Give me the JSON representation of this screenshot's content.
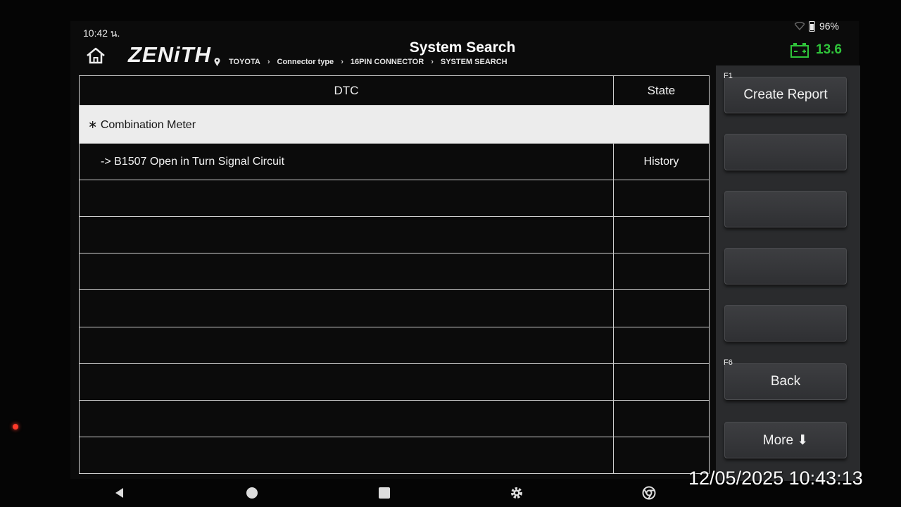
{
  "status": {
    "time": "10:42 น.",
    "battery": "96%"
  },
  "header": {
    "logo": "ZENiTH",
    "title": "System Search",
    "breadcrumb": [
      "TOYOTA",
      "Connector type",
      "16PIN CONNECTOR",
      "SYSTEM SEARCH"
    ],
    "voltage": "13.6"
  },
  "table": {
    "columns": [
      "DTC",
      "State"
    ],
    "group": "∗ Combination Meter",
    "rows": [
      {
        "code": "->  B1507 Open in Turn Signal Circuit",
        "state": "History"
      }
    ]
  },
  "fkeys": [
    {
      "fnum": "F1",
      "label": "Create Report"
    },
    {
      "fnum": "",
      "label": ""
    },
    {
      "fnum": "",
      "label": ""
    },
    {
      "fnum": "",
      "label": ""
    },
    {
      "fnum": "",
      "label": ""
    },
    {
      "fnum": "F6",
      "label": "Back"
    },
    {
      "fnum": "",
      "label": "More ⬇"
    }
  ],
  "overlay": {
    "timestamp": "12/05/2025 10:43:13"
  },
  "colors": {
    "voltage": "#2fc43a",
    "group_row": "#ececec",
    "panel": "#2a2b2d"
  },
  "icons": [
    "home-icon",
    "pin-icon",
    "battery-icon",
    "back-nav-icon",
    "home-nav-icon",
    "recents-nav-icon",
    "settings-nav-icon",
    "browser-nav-icon"
  ]
}
